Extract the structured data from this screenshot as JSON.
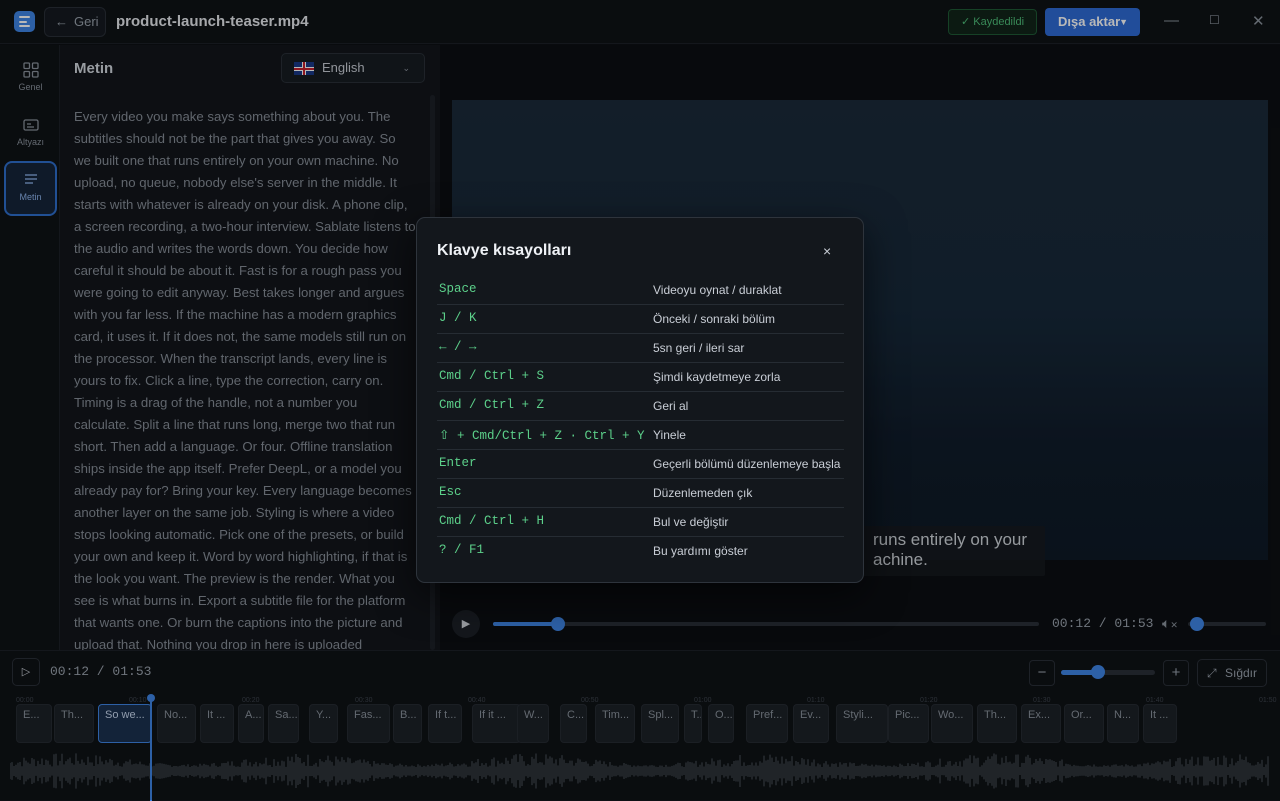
{
  "header": {
    "back_label": "Geri",
    "filename": "product-launch-teaser.mp4",
    "saved_label": "Kaydedildi",
    "export_label": "Dışa aktar"
  },
  "rail": {
    "items": [
      {
        "label": "Genel",
        "icon": "grid-icon"
      },
      {
        "label": "Altyazı",
        "icon": "subtitles-icon"
      },
      {
        "label": "Metin",
        "icon": "text-lines-icon",
        "active": true
      }
    ]
  },
  "panel": {
    "title": "Metin",
    "language": "English",
    "transcript": "Every video you make says something about you.  The subtitles should not be the part that gives you away.  So we built one that runs entirely on your own machine.  No upload, no queue, nobody else's server in the middle.  It starts with whatever is already on your disk.  A phone clip, a screen recording, a two-hour interview.  Sablate listens to the audio and writes the words down.  You decide how careful it should be about it.  Fast is for a rough pass you were going to edit anyway.  Best takes longer and argues with you far less.  If the machine has a modern graphics card, it uses it.  If it does not, the same models still run on the processor.  When the transcript lands, every line is yours to fix.  Click a line, type the correction, carry on.  Timing is a drag of the handle, not a number you calculate.  Split a line that runs long, merge two that run short.  Then add a language. Or four.  Offline translation ships inside the app itself.  Prefer DeepL, or a model you already pay for? Bring your key.  Every language becomes another layer on the same job.  Styling is where a video stops looking automatic.  Pick one of the presets, or build your own and keep it.  Word by word highlighting, if that is the look you want.  The preview is the render. What you see is what burns in.  Export a subtitle file for the platform that wants one.  Or burn the captions into the picture and upload that.  Nothing you drop in here is uploaded anywhere.  It opens"
  },
  "video": {
    "subtitle": "runs entirely on your\nachine.",
    "time": "00:12 / 01:53",
    "progress": 0.119,
    "volume": 0.05
  },
  "timeline": {
    "time": "00:12 / 01:53",
    "fit_label": "Sığdır",
    "zoom": 0.38,
    "ruler": [
      "00:00",
      "00:10",
      "00:20",
      "00:30",
      "00:40",
      "00:50",
      "01:00",
      "01:10",
      "01:20",
      "01:30",
      "01:40",
      "01:50"
    ],
    "clips": [
      "E...",
      "Th...",
      "So we...",
      "No...",
      "It ...",
      "A...",
      "Sa...",
      "Y...",
      "Fas...",
      "B...",
      "If t...",
      "If it ...",
      "W...",
      "C...",
      "Tim...",
      "Spl...",
      "T...",
      "O...",
      "Pref...",
      "Ev...",
      "Styli...",
      "Pic...",
      "Wo...",
      "Th...",
      "Ex...",
      "Or...",
      "N...",
      "It ..."
    ],
    "selected_clip": 2
  },
  "modal": {
    "title": "Klavye kısayolları",
    "close": "×",
    "shortcuts": [
      {
        "key": "Space",
        "desc": "Videoyu oynat / duraklat"
      },
      {
        "key": "J / K",
        "desc": "Önceki / sonraki bölüm"
      },
      {
        "key": "← / →",
        "desc": "5sn geri / ileri sar"
      },
      {
        "key": "Cmd / Ctrl + S",
        "desc": "Şimdi kaydetmeye zorla"
      },
      {
        "key": "Cmd / Ctrl + Z",
        "desc": "Geri al"
      },
      {
        "key": "⇧ + Cmd/Ctrl + Z · Ctrl + Y",
        "desc": "Yinele"
      },
      {
        "key": "Enter",
        "desc": "Geçerli bölümü düzenlemeye başla"
      },
      {
        "key": "Esc",
        "desc": "Düzenlemeden çık"
      },
      {
        "key": "Cmd / Ctrl + H",
        "desc": "Bul ve değiştir"
      },
      {
        "key": "? / F1",
        "desc": "Bu yardımı göster"
      }
    ]
  },
  "colors": {
    "accent": "#3f86e6",
    "saved": "#4fbf7a",
    "shortcut_key": "#5cd08a"
  }
}
